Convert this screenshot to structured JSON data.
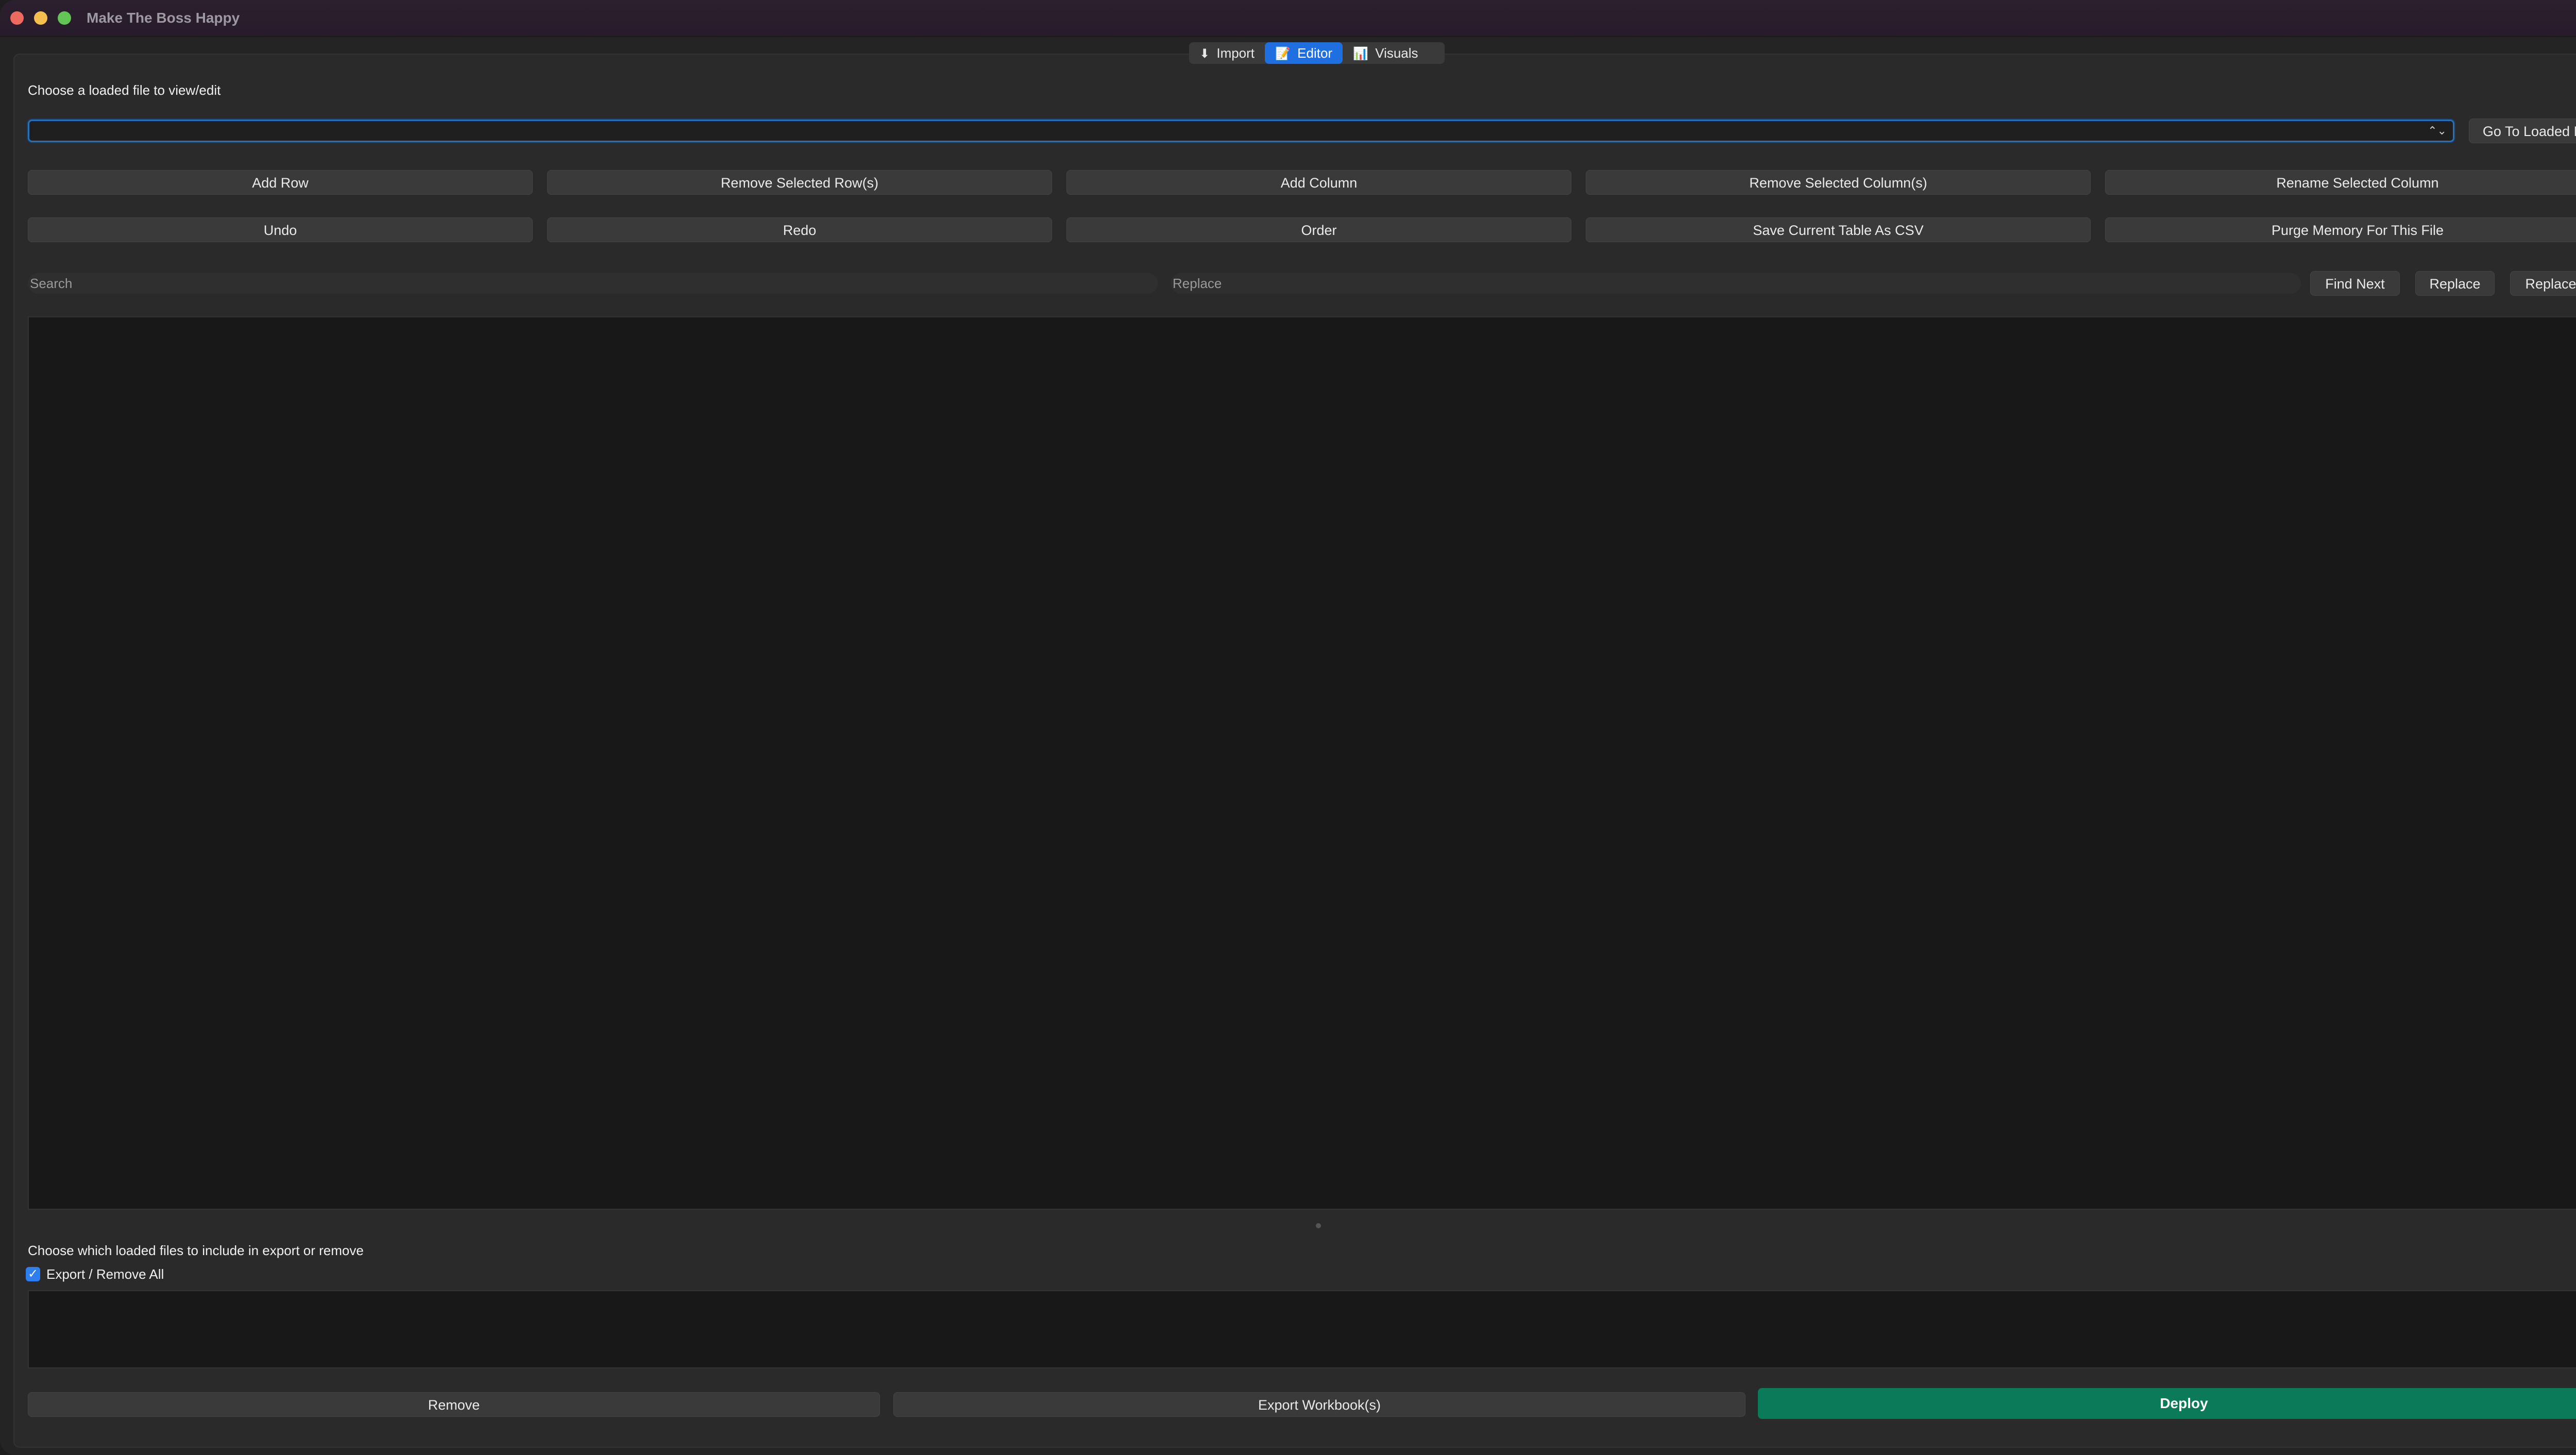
{
  "window": {
    "title": "Make The Boss Happy"
  },
  "tabs": [
    {
      "icon": "⬇",
      "icon_name": "download-icon",
      "label": "Import"
    },
    {
      "icon": "📝",
      "icon_name": "memo-icon",
      "label": "Editor",
      "active": true
    },
    {
      "icon": "📊",
      "icon_name": "bar-chart-icon",
      "label": "Visuals"
    }
  ],
  "editor": {
    "choose_label": "Choose a loaded file to view/edit",
    "file_select_value": "",
    "go_to_loaded_file": "Go To Loaded File",
    "row1": [
      "Add Row",
      "Remove Selected Row(s)",
      "Add Column",
      "Remove Selected Column(s)",
      "Rename Selected Column"
    ],
    "row2": [
      "Undo",
      "Redo",
      "Order",
      "Save Current Table As CSV",
      "Purge Memory For This File"
    ],
    "search_placeholder": "Search",
    "replace_placeholder": "Replace",
    "find_next": "Find Next",
    "replace": "Replace",
    "replace_all": "Replace All"
  },
  "export": {
    "label": "Choose which loaded files to include in export or remove",
    "select_all_label": "Export / Remove All",
    "select_all_checked": true,
    "remove": "Remove",
    "export_workbooks": "Export Workbook(s)",
    "deploy": "Deploy"
  },
  "colors": {
    "accent": "#1f6fe0",
    "deploy": "#0a7a58",
    "checkbox": "#2f7ef0"
  }
}
